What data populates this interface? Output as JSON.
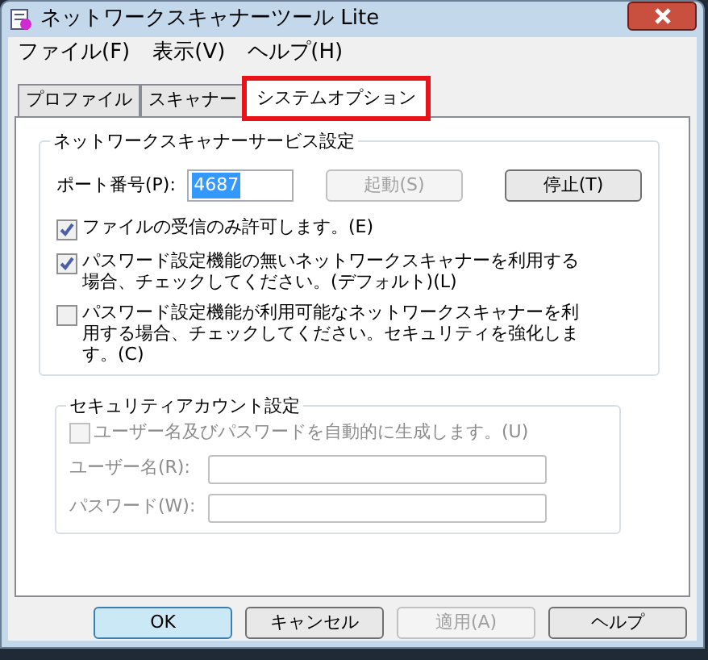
{
  "window": {
    "title": "ネットワークスキャナーツール Lite"
  },
  "menu": [
    "ファイル(F)",
    "表示(V)",
    "ヘルプ(H)"
  ],
  "tabs": [
    {
      "label": "プロファイル",
      "selected": false,
      "highlighted": false
    },
    {
      "label": "スキャナー",
      "selected": false,
      "highlighted": false
    },
    {
      "label": "システムオプション",
      "selected": true,
      "highlighted": true
    }
  ],
  "service_group": {
    "title": "ネットワークスキャナーサービス設定",
    "port_label": "ポート番号(P):",
    "port_value": "4687",
    "buttons": [
      {
        "label": "起動(S)",
        "disabled": true
      },
      {
        "label": "停止(T)",
        "disabled": false
      }
    ],
    "options": [
      {
        "label": "ファイルの受信のみ許可します。(E)",
        "checked": true
      },
      {
        "label": "パスワード設定機能の無いネットワークスキャナーを利用する場合、チェックしてください。(デフォルト)(L)",
        "checked": true
      },
      {
        "label": "パスワード設定機能が利用可能なネットワークスキャナーを利用する場合、チェックしてください。セキュリティを強化します。(C)",
        "checked": false
      }
    ]
  },
  "account_group": {
    "title": "セキュリティアカウント設定",
    "disabled": true,
    "auto_generate": {
      "label": "ユーザー名及びパスワードを自動的に生成します。(U)",
      "checked": false
    },
    "fields": [
      {
        "label": "ユーザー名(R):"
      },
      {
        "label": "パスワード(W):"
      }
    ]
  },
  "buttons": [
    {
      "label": "OK",
      "disabled": false,
      "default": true
    },
    {
      "label": "キャンセル",
      "disabled": false,
      "default": false
    },
    {
      "label": "適用(A)",
      "disabled": true,
      "default": false
    },
    {
      "label": "ヘルプ",
      "disabled": false,
      "default": false
    }
  ]
}
